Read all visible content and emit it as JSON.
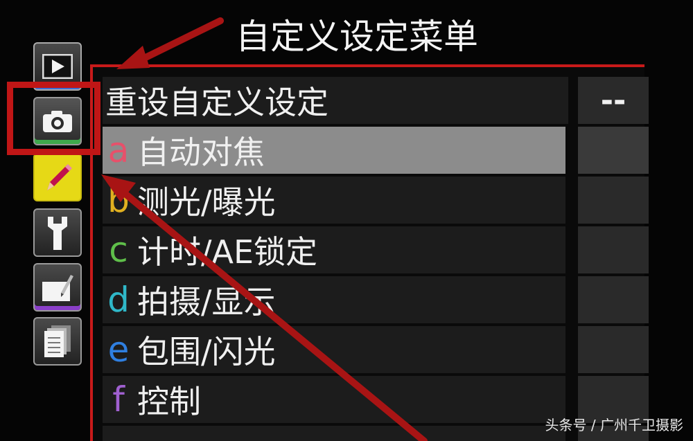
{
  "menu": {
    "title": "自定义设定菜单",
    "reset_row": {
      "label": "重设自定义设定",
      "value": "--"
    },
    "items": [
      {
        "letter": "a",
        "label": "自动对焦",
        "color": "#e8506a"
      },
      {
        "letter": "b",
        "label": "测光/曝光",
        "color": "#e0b020"
      },
      {
        "letter": "c",
        "label": "计时/AE锁定",
        "color": "#5fbf4a"
      },
      {
        "letter": "d",
        "label": "拍摄/显示",
        "color": "#2fb8c8"
      },
      {
        "letter": "e",
        "label": "包围/闪光",
        "color": "#2f7fe0"
      },
      {
        "letter": "f",
        "label": "控制",
        "color": "#a060d0"
      }
    ],
    "selected_index": 0
  },
  "tabs": [
    {
      "name": "playback",
      "icon": "play-icon"
    },
    {
      "name": "shooting",
      "icon": "camera-icon"
    },
    {
      "name": "custom-settings",
      "icon": "pencil-icon"
    },
    {
      "name": "setup",
      "icon": "wrench-icon"
    },
    {
      "name": "retouch",
      "icon": "retouch-icon"
    },
    {
      "name": "recent-settings",
      "icon": "pages-icon"
    }
  ],
  "accent_colors": {
    "annotation_red": "#c01616",
    "custom_tab_yellow": "#e6d916"
  },
  "watermark": "头条号 / 广州千卫摄影"
}
